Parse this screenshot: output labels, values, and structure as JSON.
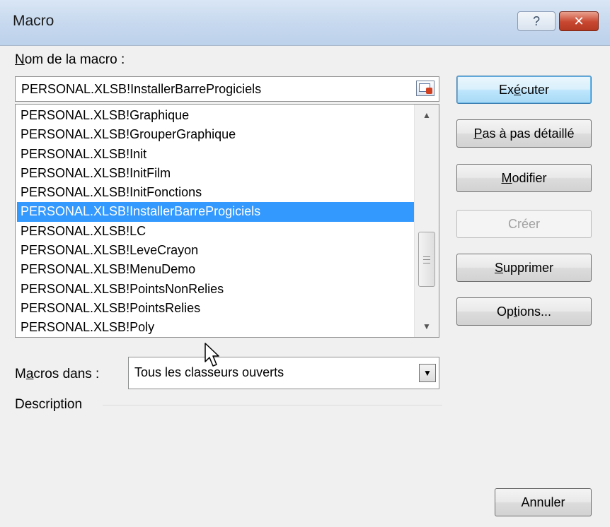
{
  "window": {
    "title": "Macro",
    "help_glyph": "?",
    "close_glyph": "✕"
  },
  "macro_name": {
    "label_underlined": "N",
    "label_rest": "om de la macro :",
    "value": "PERSONAL.XLSB!InstallerBarreProgiciels"
  },
  "macro_list": {
    "items": [
      "PERSONAL.XLSB!Graphique",
      "PERSONAL.XLSB!GrouperGraphique",
      "PERSONAL.XLSB!Init",
      "PERSONAL.XLSB!InitFilm",
      "PERSONAL.XLSB!InitFonctions",
      "PERSONAL.XLSB!InstallerBarreProgiciels",
      "PERSONAL.XLSB!LC",
      "PERSONAL.XLSB!LeveCrayon",
      "PERSONAL.XLSB!MenuDemo",
      "PERSONAL.XLSB!PointsNonRelies",
      "PERSONAL.XLSB!PointsRelies",
      "PERSONAL.XLSB!Poly"
    ],
    "selected_index": 5
  },
  "buttons": {
    "executer": {
      "pre": "Ex",
      "u": "é",
      "post": "cuter"
    },
    "pas_a_pas": {
      "pre": "",
      "u": "P",
      "post": "as à pas détaillé"
    },
    "modifier": {
      "pre": "",
      "u": "M",
      "post": "odifier"
    },
    "creer": {
      "label": "Créer"
    },
    "supprimer": {
      "pre": "",
      "u": "S",
      "post": "upprimer"
    },
    "options": {
      "pre": "Op",
      "u": "t",
      "post": "ions..."
    },
    "annuler": {
      "label": "Annuler"
    }
  },
  "macros_dans": {
    "label_pre": "M",
    "label_u": "a",
    "label_post": "cros dans :",
    "value": "Tous les classeurs ouverts"
  },
  "description": {
    "label": "Description"
  },
  "colors": {
    "selection": "#3399ff",
    "title_bar": "#c6d8ee",
    "close_button": "#c8462f"
  }
}
